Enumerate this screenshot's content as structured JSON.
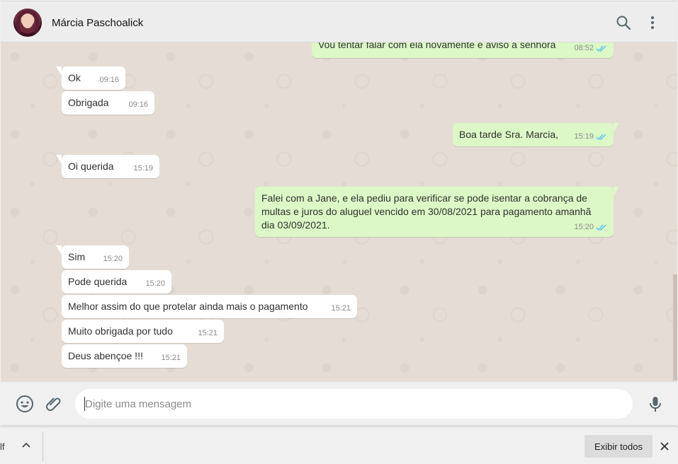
{
  "header": {
    "contact_name": "Márcia Paschoalick"
  },
  "messages": [
    {
      "dir": "out",
      "text": "Vou tentar falar com ela novamente e aviso a senhora",
      "time": "08:52",
      "status": "read"
    },
    {
      "dir": "in",
      "text": "Ok",
      "time": "09:16"
    },
    {
      "dir": "in",
      "text": "Obrigada",
      "time": "09:16"
    },
    {
      "dir": "out",
      "text": "Boa tarde Sra. Marcia,",
      "time": "15:19",
      "status": "read"
    },
    {
      "dir": "in",
      "text": "Oi querida",
      "time": "15:19"
    },
    {
      "dir": "out",
      "text": "Falei com a Jane, e ela pediu para verificar se pode isentar a cobrança de multas e juros do aluguel vencido em 30/08/2021 para pagamento amanhã dia 03/09/2021.",
      "time": "15:20",
      "status": "read"
    },
    {
      "dir": "in",
      "text": "Sim",
      "time": "15:20"
    },
    {
      "dir": "in",
      "text": "Pode querida",
      "time": "15:20"
    },
    {
      "dir": "in",
      "text": "Melhor assim do que protelar ainda mais o pagamento",
      "time": "15:21"
    },
    {
      "dir": "in",
      "text": "Muito obrigada por tudo",
      "time": "15:21"
    },
    {
      "dir": "in",
      "text": "Deus abençoe !!!",
      "time": "15:21"
    }
  ],
  "composer": {
    "placeholder": "Digite uma mensagem"
  },
  "downloads": {
    "file_fragment": "lf",
    "show_all_label": "Exibir todos"
  },
  "colors": {
    "incoming_bubble": "#ffffff",
    "outgoing_bubble": "#dcf8c6",
    "chat_background": "#e5ddd5",
    "read_ticks": "#4fc3f7"
  },
  "icons": {
    "search": "search-icon",
    "menu": "kebab-menu-icon",
    "emoji": "emoji-icon",
    "attach": "paperclip-icon",
    "mic": "microphone-icon",
    "chevron": "chevron-up-icon",
    "close": "close-icon"
  }
}
